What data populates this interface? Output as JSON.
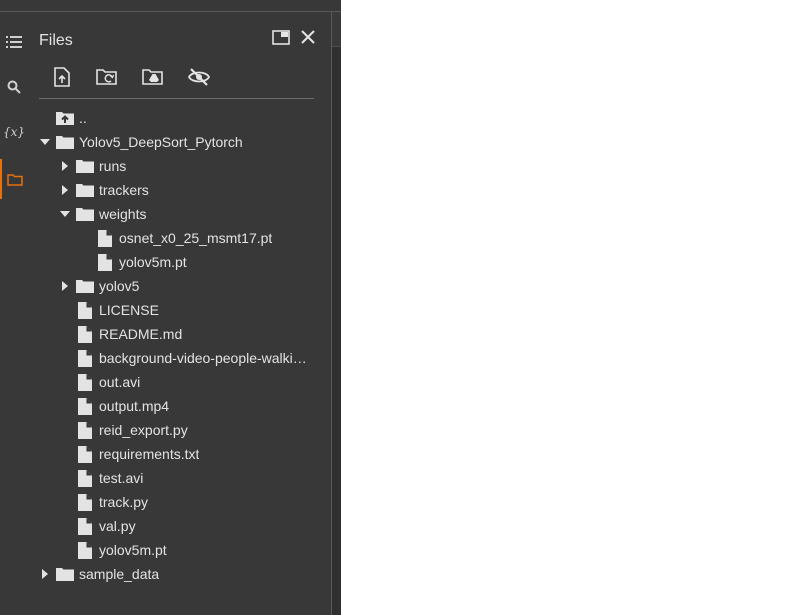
{
  "panel": {
    "title": "Files",
    "header_buttons": [
      "open-in-new-window-icon",
      "close-icon"
    ],
    "toolbar": [
      "upload-file-icon",
      "refresh-folder-icon",
      "mount-drive-icon",
      "hide-files-icon"
    ]
  },
  "rail": {
    "items": [
      "table-of-contents-icon",
      "search-icon",
      "variables-icon",
      "folder-icon"
    ],
    "variables_glyph": "{x}",
    "active_item": "folder-icon",
    "accent_color": "#e8710a"
  },
  "tree": {
    "parent": "..",
    "root_folder": "Yolov5_DeepSort_Pytorch",
    "runs": "runs",
    "trackers": "trackers",
    "weights": "weights",
    "weights_files": [
      "osnet_x0_25_msmt17.pt",
      "yolov5m.pt"
    ],
    "yolov5": "yolov5",
    "files": [
      "LICENSE",
      "README.md",
      "background-video-people-walki…",
      "out.avi",
      "output.mp4",
      "reid_export.py",
      "requirements.txt",
      "test.avi",
      "track.py",
      "val.py",
      "yolov5m.pt"
    ],
    "sample_data": "sample_data"
  }
}
